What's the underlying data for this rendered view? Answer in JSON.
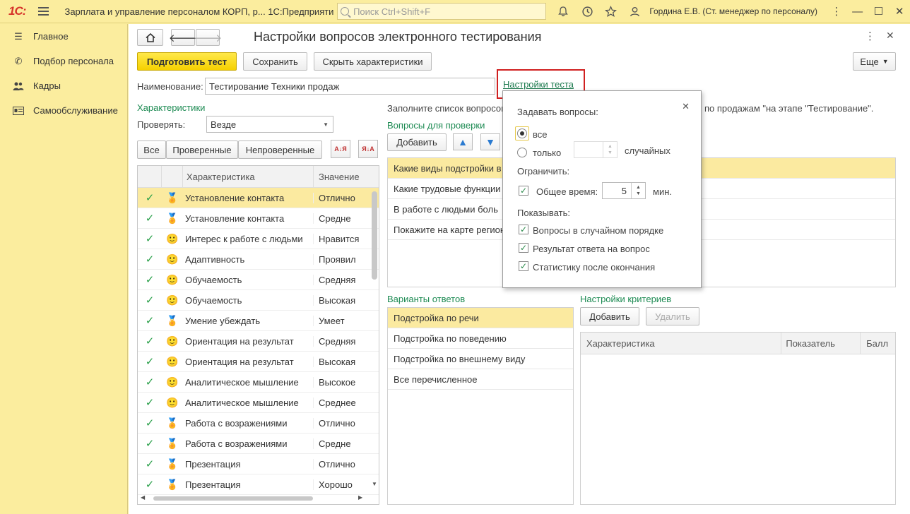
{
  "topbar": {
    "logo": "1С:",
    "app_title": "Зарплата и управление персоналом КОРП, р... 1С:Предприятие",
    "search_placeholder": "Поиск Ctrl+Shift+F",
    "user": "Гордина Е.В. (Ст. менеджер по персоналу)"
  },
  "sidebar": {
    "items": [
      {
        "label": "Главное",
        "icon": "menu-icon"
      },
      {
        "label": "Подбор персонала",
        "icon": "phone-icon"
      },
      {
        "label": "Кадры",
        "icon": "people-icon"
      },
      {
        "label": "Самообслуживание",
        "icon": "card-icon"
      }
    ]
  },
  "form": {
    "title": "Настройки вопросов электронного тестирования",
    "prepare_label": "Подготовить тест",
    "save_label": "Сохранить",
    "hide_label": "Скрыть характеристики",
    "more_label": "Еще",
    "name_label": "Наименование:",
    "name_value": "Тестирование Техники продаж",
    "settings_link": "Настройки теста",
    "hint_left": "Заполните список вопросов",
    "hint_right": "по продажам \"на этапе \"Тестирование\"."
  },
  "characteristics": {
    "heading": "Характеристики",
    "check_label": "Проверять:",
    "check_value": "Везде",
    "filter_all": "Все",
    "filter_checked": "Проверенные",
    "filter_unchecked": "Непроверенные",
    "col_char": "Характеристика",
    "col_value": "Значение",
    "rows": [
      {
        "name": "Установление контакта",
        "value": "Отлично",
        "icon": "medal"
      },
      {
        "name": "Установление контакта",
        "value": "Средне",
        "icon": "medal"
      },
      {
        "name": "Интерес к работе с людьми",
        "value": "Нравится",
        "icon": "smile"
      },
      {
        "name": "Адаптивность",
        "value": "Проявил",
        "icon": "smile"
      },
      {
        "name": "Обучаемость",
        "value": "Средняя",
        "icon": "smile"
      },
      {
        "name": "Обучаемость",
        "value": "Высокая",
        "icon": "smile"
      },
      {
        "name": "Умение убеждать",
        "value": "Умеет",
        "icon": "medal"
      },
      {
        "name": "Ориентация на результат",
        "value": "Средняя",
        "icon": "smile"
      },
      {
        "name": "Ориентация на результат",
        "value": "Высокая",
        "icon": "smile"
      },
      {
        "name": "Аналитическое мышление",
        "value": "Высокое",
        "icon": "smile"
      },
      {
        "name": "Аналитическое мышление",
        "value": "Среднее",
        "icon": "smile"
      },
      {
        "name": "Работа с возражениями",
        "value": "Отлично",
        "icon": "medal"
      },
      {
        "name": "Работа с возражениями",
        "value": "Средне",
        "icon": "medal"
      },
      {
        "name": "Презентация",
        "value": "Отлично",
        "icon": "medal"
      },
      {
        "name": "Презентация",
        "value": "Хорошо",
        "icon": "medal"
      }
    ]
  },
  "questions": {
    "heading": "Вопросы для проверки",
    "add_label": "Добавить",
    "rows": [
      "Какие виды подстройки в",
      "Какие трудовые функции",
      "В работе с людьми боль",
      "Покажите на карте регион"
    ]
  },
  "answers": {
    "heading": "Варианты ответов",
    "rows": [
      "Подстройка по речи",
      "Подстройка по поведению",
      "Подстройка по внешнему виду",
      "Все перечисленное"
    ]
  },
  "criteria": {
    "heading": "Настройки критериев",
    "add_label": "Добавить",
    "delete_label": "Удалить",
    "col_char": "Характеристика",
    "col_indicator": "Показатель",
    "col_score": "Балл"
  },
  "popup": {
    "ask_label": "Задавать вопросы:",
    "all_label": "все",
    "only_label": "только",
    "random_label": "случайных",
    "limit_label": "Ограничить:",
    "total_time_label": "Общее время:",
    "total_time_value": "5",
    "minutes_label": "мин.",
    "show_label": "Показывать:",
    "opt_random_order": "Вопросы в случайном порядке",
    "opt_result": "Результат ответа на вопрос",
    "opt_stats": "Статистику после окончания"
  }
}
